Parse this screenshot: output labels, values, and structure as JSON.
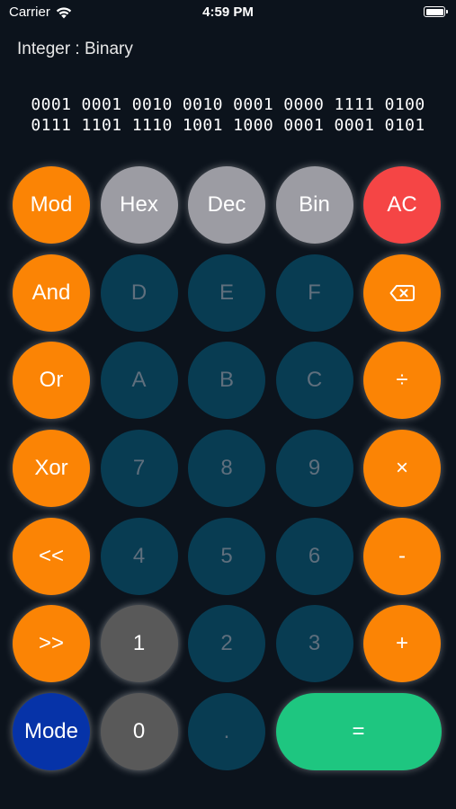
{
  "status": {
    "carrier": "Carrier",
    "time": "4:59 PM"
  },
  "mode_label": "Integer : Binary",
  "display": {
    "line1": "0001 0001 0010 0010 0001 0000 1111 0100",
    "line2": "0111 1101 1110 1001 1000 0001 0001 0101"
  },
  "keys": {
    "mod": "Mod",
    "hex": "Hex",
    "dec": "Dec",
    "bin": "Bin",
    "ac": "AC",
    "and": "And",
    "d": "D",
    "e": "E",
    "f": "F",
    "or": "Or",
    "a": "A",
    "b": "B",
    "c": "C",
    "divide": "÷",
    "xor": "Xor",
    "seven": "7",
    "eight": "8",
    "nine": "9",
    "multiply": "×",
    "shift_left": "<<",
    "four": "4",
    "five": "5",
    "six": "6",
    "minus": "-",
    "shift_right": ">>",
    "one": "1",
    "two": "2",
    "three": "3",
    "plus": "+",
    "mode": "Mode",
    "zero": "0",
    "dot": ".",
    "equals": "="
  },
  "colors": {
    "background": "#0c131c",
    "operator": "#fb8405",
    "base_selector": "#9c9ca3",
    "clear": "#f54545",
    "disabled_digit": "#083c52",
    "enabled_digit": "#595959",
    "mode": "#0633a8",
    "equals": "#1ec680"
  },
  "icons": {
    "wifi": "wifi-icon",
    "battery": "battery-icon",
    "backspace": "backspace-icon"
  }
}
